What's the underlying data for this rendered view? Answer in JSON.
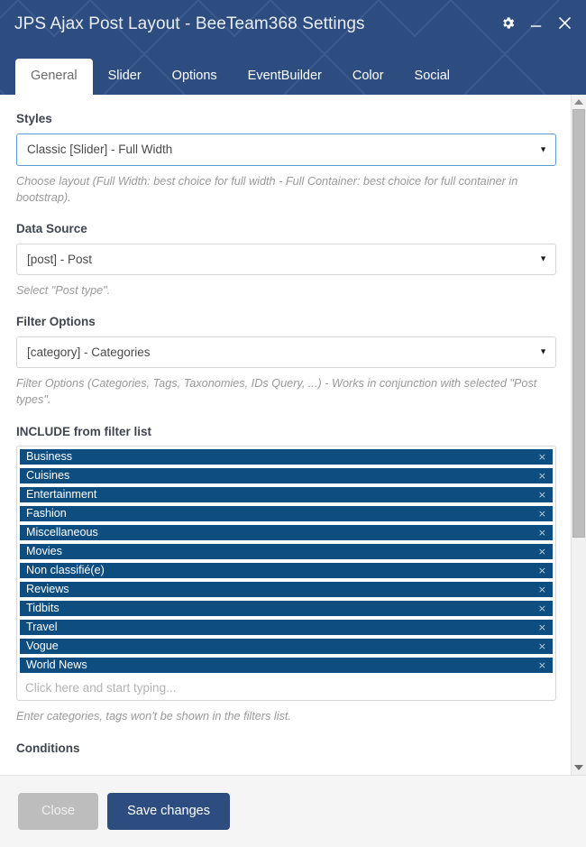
{
  "window": {
    "title": "JPS Ajax Post Layout - BeeTeam368 Settings",
    "controls": [
      {
        "name": "settings-gear-button",
        "icon": "gear-icon",
        "label": "Settings"
      },
      {
        "name": "minimize-button",
        "icon": "minimize-icon",
        "label": "Minimize"
      },
      {
        "name": "close-window-button",
        "icon": "close-icon",
        "label": "Close"
      }
    ],
    "header_color": "#2d4d80"
  },
  "tabs": [
    {
      "id": "general",
      "label": "General",
      "active": true
    },
    {
      "id": "slider",
      "label": "Slider",
      "active": false
    },
    {
      "id": "options",
      "label": "Options",
      "active": false
    },
    {
      "id": "eventbuilder",
      "label": "EventBuilder",
      "active": false
    },
    {
      "id": "color",
      "label": "Color",
      "active": false
    },
    {
      "id": "social",
      "label": "Social",
      "active": false
    }
  ],
  "form": {
    "styles": {
      "label": "Styles",
      "value": "Classic [Slider] - Full Width",
      "help": "Choose layout (Full Width: best choice for full width - Full Container: best choice for full container in bootstrap).",
      "focused": true
    },
    "data_source": {
      "label": "Data Source",
      "value": "[post] - Post",
      "help": "Select \"Post type\"."
    },
    "filter_options": {
      "label": "Filter Options",
      "value": "[category] - Categories",
      "help": "Filter Options (Categories, Tags, Taxonomies, IDs Query, ...) - Works in conjunction with selected \"Post types\"."
    },
    "include_filter_list": {
      "label": "INCLUDE from filter list",
      "tokens": [
        "Business",
        "Cuisines",
        "Entertainment",
        "Fashion",
        "Miscellaneous",
        "Movies",
        "Non classifié(e)",
        "Reviews",
        "Tidbits",
        "Travel",
        "Vogue",
        "World News"
      ],
      "token_remove_glyph": "×",
      "input_value": "",
      "input_placeholder": "Click here and start typing...",
      "help": "Enter categories, tags won't be shown in the filters list.",
      "token_color": "#0e4d80"
    },
    "conditions": {
      "label": "Conditions"
    }
  },
  "footer": {
    "close_label": "Close",
    "save_label": "Save changes",
    "close_color": "#bdbdbd",
    "save_color": "#2d4d80"
  },
  "scrollbar": {
    "up_arrow": "scroll-up-arrow",
    "down_arrow": "scroll-down-arrow"
  }
}
